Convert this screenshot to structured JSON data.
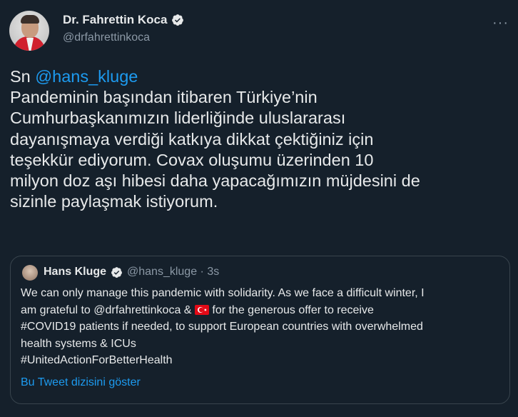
{
  "author": {
    "display_name": "Dr. Fahrettin Koca",
    "handle": "@drfahrettinkoca"
  },
  "more_icon": "···",
  "tweet": {
    "greeting": "Sn ",
    "mention": "@hans_kluge",
    "lines": [
      "Pandeminin başından itibaren Türkiye’nin",
      "Cumhurbaşkanımızın liderliğinde uluslararası",
      "dayanışmaya verdiği katkıya dikkat çektiğiniz için",
      "teşekkür ediyorum. Covax oluşumu üzerinden 10",
      "milyon doz aşı hibesi daha yapacağımızın müjdesini de",
      "sizinle paylaşmak istiyorum."
    ]
  },
  "quoted": {
    "display_name": "Hans Kluge",
    "meta": "@hans_kluge · 3s",
    "line1": "We can only manage this pandemic with solidarity. As we face a difficult winter, I",
    "line2_before": "am grateful to @drfahrettinkoca & ",
    "line2_after": " for the generous offer to receive",
    "line3": "#COVID19 patients if needed, to support European countries with overwhelmed",
    "line4": "health systems & ICUs",
    "line5": "#UnitedActionForBetterHealth",
    "thread_link": "Bu Tweet dizisini göster"
  },
  "icons": {
    "verified": "verified-badge-icon",
    "flag": "turkey-flag-icon",
    "more": "more-options-icon"
  },
  "colors": {
    "background": "#15202b",
    "link": "#1d9bf0",
    "secondary_text": "#8b98a5",
    "border": "#38444d"
  }
}
